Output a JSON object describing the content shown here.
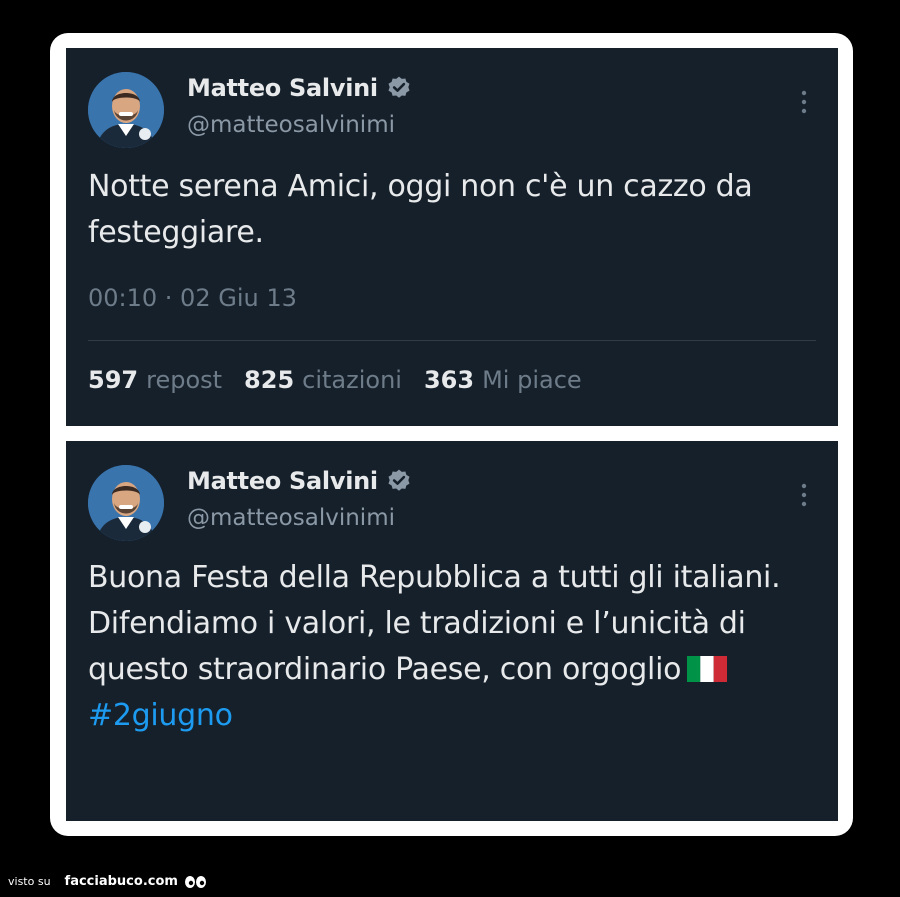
{
  "tweets": [
    {
      "name": "Matteo Salvini",
      "handle": "@matteosalvinimi",
      "text": "Notte serena Amici, oggi non c'è un cazzo da festeggiare.",
      "meta": "00:10 · 02 Giu 13",
      "stats": [
        {
          "num": "597",
          "label": "repost"
        },
        {
          "num": "825",
          "label": "citazioni"
        },
        {
          "num": "363",
          "label": "Mi piace"
        }
      ]
    },
    {
      "name": "Matteo Salvini",
      "handle": "@matteosalvinimi",
      "line1": "Buona Festa della Repubblica a tutti gli italiani.",
      "line2": "Difendiamo i valori, le tradizioni e l’unicità di questo straordinario Paese, con orgoglio",
      "hashtag": "#2giugno"
    }
  ],
  "footer": {
    "prefix": "visto su",
    "site": "facciabuco.com"
  },
  "colors": {
    "tweet_bg": "#15202b",
    "hashtag": "#1d9bf0",
    "secondary_text": "#8b98a5"
  },
  "icons": [
    "avatar",
    "verified-badge-icon",
    "more-options-icon",
    "italian-flag-icon",
    "eyes-icon"
  ]
}
